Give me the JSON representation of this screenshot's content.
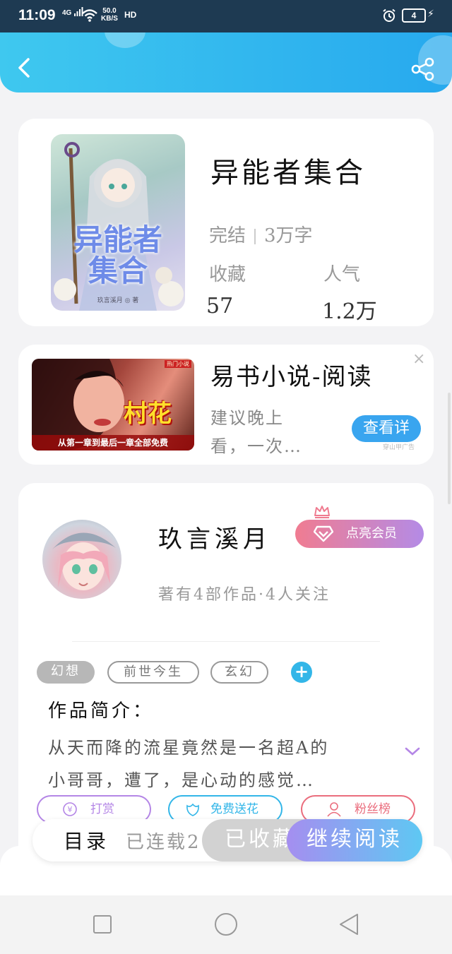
{
  "status_bar": {
    "time": "11:09",
    "network": "4G",
    "speed_value": "50.0",
    "speed_unit": "KB/S",
    "hd": "HD",
    "battery": "4"
  },
  "book": {
    "cover_title_line1": "异能者",
    "cover_title_line2": "集合",
    "cover_author": "玖言溪月 ◎ 著",
    "title": "异能者集合",
    "status": "完结",
    "word_count": "3万字",
    "favorites_label": "收藏",
    "popularity_label": "人气",
    "favorites_value": "57",
    "popularity_value": "1.2万"
  },
  "ad": {
    "image_tag": "热门小说",
    "image_headline": "村花",
    "image_strip": "从第一章到最后一章全部免费",
    "title": "易书小说-阅读",
    "desc_line1": "建议晚上",
    "desc_line2": "看，一次…",
    "button": "查看详",
    "close": "×",
    "source": "穿山甲广告"
  },
  "author": {
    "name": "玖言溪月",
    "vip_button": "点亮会员",
    "stats": "著有4部作品·4人关注"
  },
  "tags": [
    "幻想",
    "前世今生",
    "玄幻"
  ],
  "tag_add": "+",
  "intro": {
    "heading": "作品简介：",
    "line1": "从天而降的流星竟然是一名超A的",
    "line2": "小哥哥，遭了，是心动的感觉…"
  },
  "actions": {
    "reward": "打赏",
    "flowers": "免费送花",
    "fans": "粉丝榜"
  },
  "bottom": {
    "toc": "目录",
    "serial": "已连载2",
    "collect": "已收藏",
    "read": "继续阅读"
  },
  "colors": {
    "header_start": "#3fc8ef",
    "header_end": "#27a9ee",
    "accent_blue": "#39a5ef",
    "reward_purple": "#b486e6",
    "flower_cyan": "#33b6e8",
    "fans_red": "#ea6d7d"
  }
}
